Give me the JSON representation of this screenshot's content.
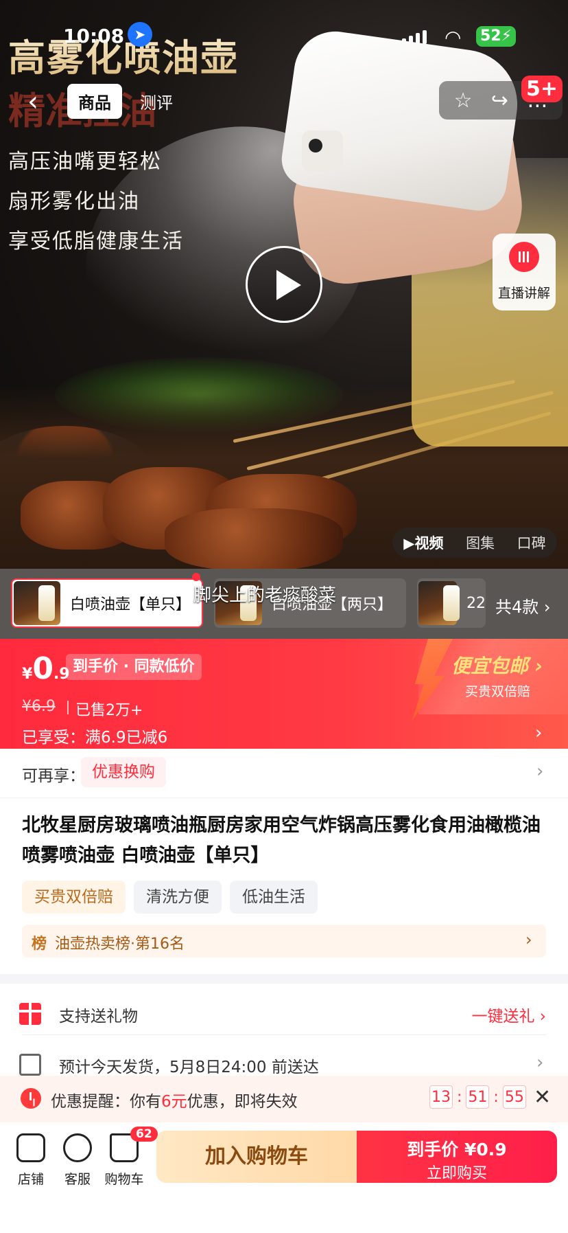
{
  "status_bar": {
    "time": "10:08"
  },
  "hero": {
    "promo_title": "高雾化喷油壶",
    "promo_title2": "精准控油",
    "promo_lines": [
      "高压油嘴更轻松",
      "扇形雾化出油",
      "享受低脂健康生活"
    ],
    "nav_tabs": [
      "商品",
      "测评"
    ],
    "msg_badge": "5+",
    "live_label": "直播讲解",
    "media_tabs": [
      "▶视频",
      "图集",
      "口碑"
    ]
  },
  "variants": {
    "items": [
      "白喷油壶【单只】",
      "白喷油壶【两只】",
      "22"
    ],
    "count_label": "共4款",
    "overlay_text": "脚尖上的老痰酸菜"
  },
  "price": {
    "currency": "¥",
    "int": "0",
    "dec": ".9",
    "tag": "到手价 · 同款低价",
    "original": "¥6.9",
    "sold": "已售2万+",
    "enjoyed": "已享受：满6.9已减6",
    "ship_title": "便宜包邮 ›",
    "ship_sub": "买贵双倍赔"
  },
  "redeem": {
    "label": "可再享：",
    "tag": "优惠换购"
  },
  "product": {
    "title": "北牧星厨房玻璃喷油瓶厨房家用空气炸锅高压雾化食用油橄榄油喷雾喷油壶 白喷油壶【单只】",
    "chips": [
      "买贵双倍赔",
      "清洗方便",
      "低油生活"
    ],
    "rank_icon": "榜",
    "rank_text": "油壶热卖榜·第16名"
  },
  "gift_row": {
    "text": "支持送礼物",
    "action": "一键送礼 ›"
  },
  "delivery_row": {
    "text": "预计今天发货，5月8日24:00 前送达"
  },
  "reminder": {
    "prefix": "优惠提醒：你有",
    "amount": "6元",
    "suffix": "优惠，即将失效",
    "hours": "13",
    "minutes": "51",
    "seconds": "55"
  },
  "bottom_bar": {
    "shop": "店铺",
    "service": "客服",
    "cart": "购物车",
    "cart_badge": "62",
    "add_cart": "加入购物车",
    "buy_top": "到手价 ¥0.9",
    "buy_bottom": "立即购买"
  },
  "colors": {
    "accent": "#ff2d3d",
    "warm": "#ffd9a8"
  }
}
